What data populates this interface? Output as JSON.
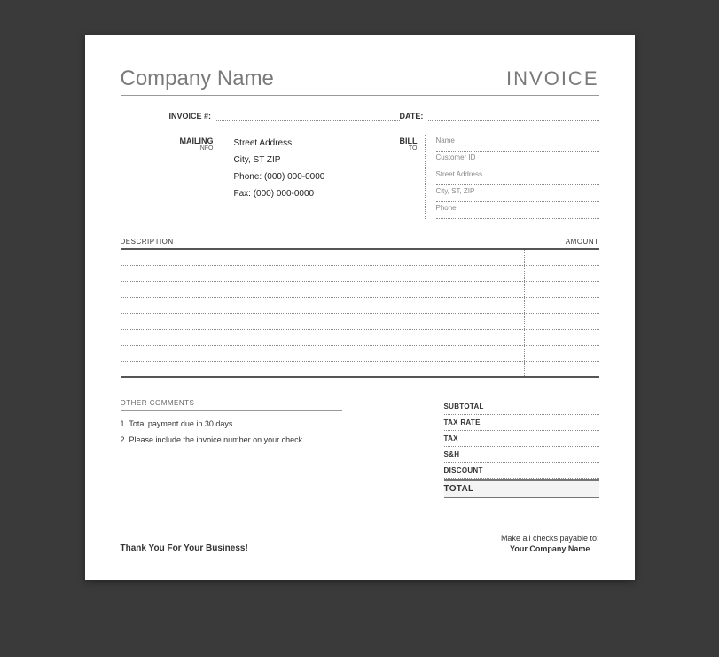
{
  "header": {
    "company_name": "Company Name",
    "document_title": "INVOICE"
  },
  "meta": {
    "invoice_number_label": "INVOICE #:",
    "date_label": "DATE:"
  },
  "mailing": {
    "label_line1": "MAILING",
    "label_line2": "INFO",
    "street": "Street Address",
    "city_st_zip": "City, ST  ZIP",
    "phone": "Phone: (000) 000-0000",
    "fax": "Fax: (000) 000-0000"
  },
  "billto": {
    "label_line1": "BILL",
    "label_line2": "TO",
    "name_hint": "Name",
    "customer_hint": "Customer ID",
    "street_hint": "Street Address",
    "city_hint": "City, ST, ZIP",
    "phone_hint": "Phone"
  },
  "items": {
    "description_header": "DESCRIPTION",
    "amount_header": "AMOUNT"
  },
  "comments": {
    "header": "OTHER COMMENTS",
    "line1": "1. Total payment due in 30 days",
    "line2": "2. Please include the invoice number on your check"
  },
  "totals": {
    "subtotal_label": "SUBTOTAL",
    "taxrate_label": "TAX RATE",
    "tax_label": "TAX",
    "sh_label": "S&H",
    "discount_label": "DISCOUNT",
    "total_label": "TOTAL"
  },
  "footer": {
    "thanks": "Thank You For Your Business!",
    "payable_text": "Make all checks payable to:",
    "payable_name": "Your Company Name"
  }
}
